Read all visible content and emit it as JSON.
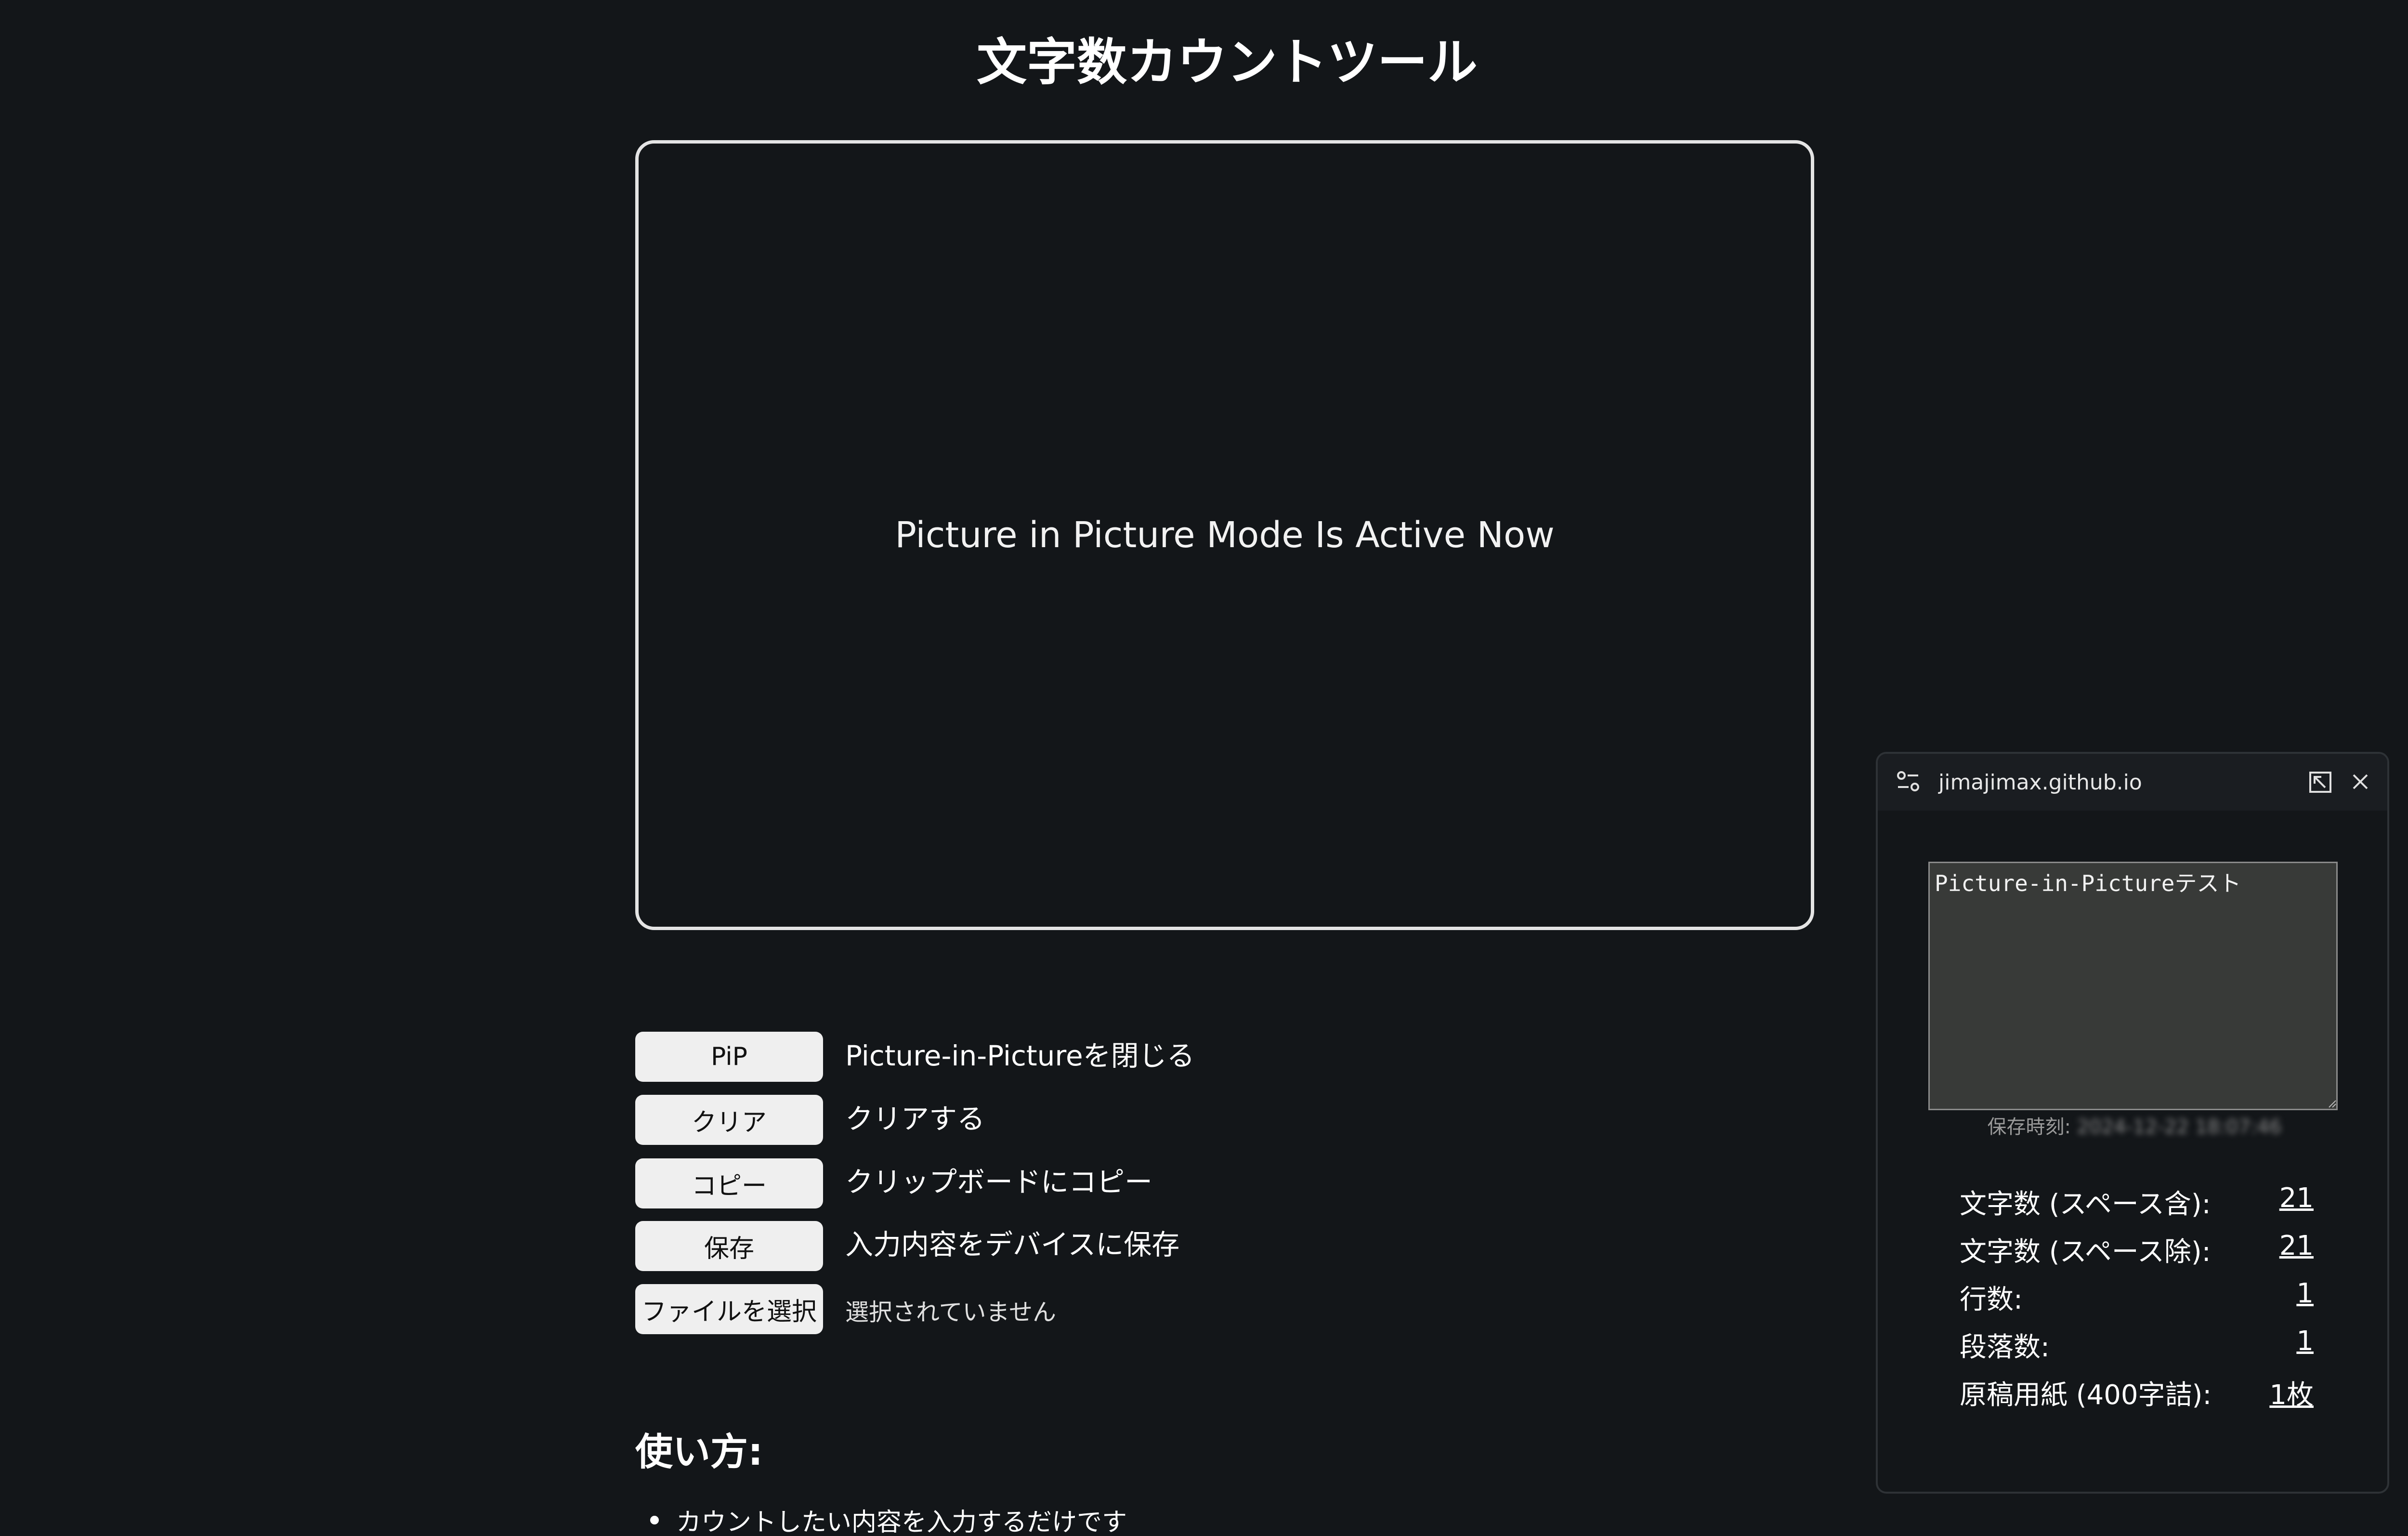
{
  "page": {
    "title": "文字数カウントツール",
    "video_message": "Picture in Picture Mode Is Active Now"
  },
  "buttons": [
    {
      "label": "PiP",
      "description": "Picture-in-Pictureを閉じる"
    },
    {
      "label": "クリア",
      "description": "クリアする"
    },
    {
      "label": "コピー",
      "description": "クリップボードにコピー"
    },
    {
      "label": "保存",
      "description": "入力内容をデバイスに保存"
    },
    {
      "label": "ファイルを選択",
      "description": "選択されていません"
    }
  ],
  "howto": {
    "heading": "使い方:",
    "items": [
      "カウントしたい内容を入力するだけです"
    ]
  },
  "pip_window": {
    "domain": "jimajimax.github.io",
    "textarea_value": "Picture-in-Pictureテスト",
    "saved_label": "保存時刻:",
    "saved_value": "2024-12-22 18:07:46",
    "stats": [
      {
        "label": "文字数 (スペース含):",
        "value": "21"
      },
      {
        "label": "文字数 (スペース除):",
        "value": "21"
      },
      {
        "label": "行数:",
        "value": "1"
      },
      {
        "label": "段落数:",
        "value": "1"
      },
      {
        "label": "原稿用紙 (400字詰):",
        "value": "1枚"
      }
    ]
  },
  "icons": {
    "settings": "tune-settings-icon",
    "restore": "back-to-tab-icon",
    "close": "close-icon"
  }
}
